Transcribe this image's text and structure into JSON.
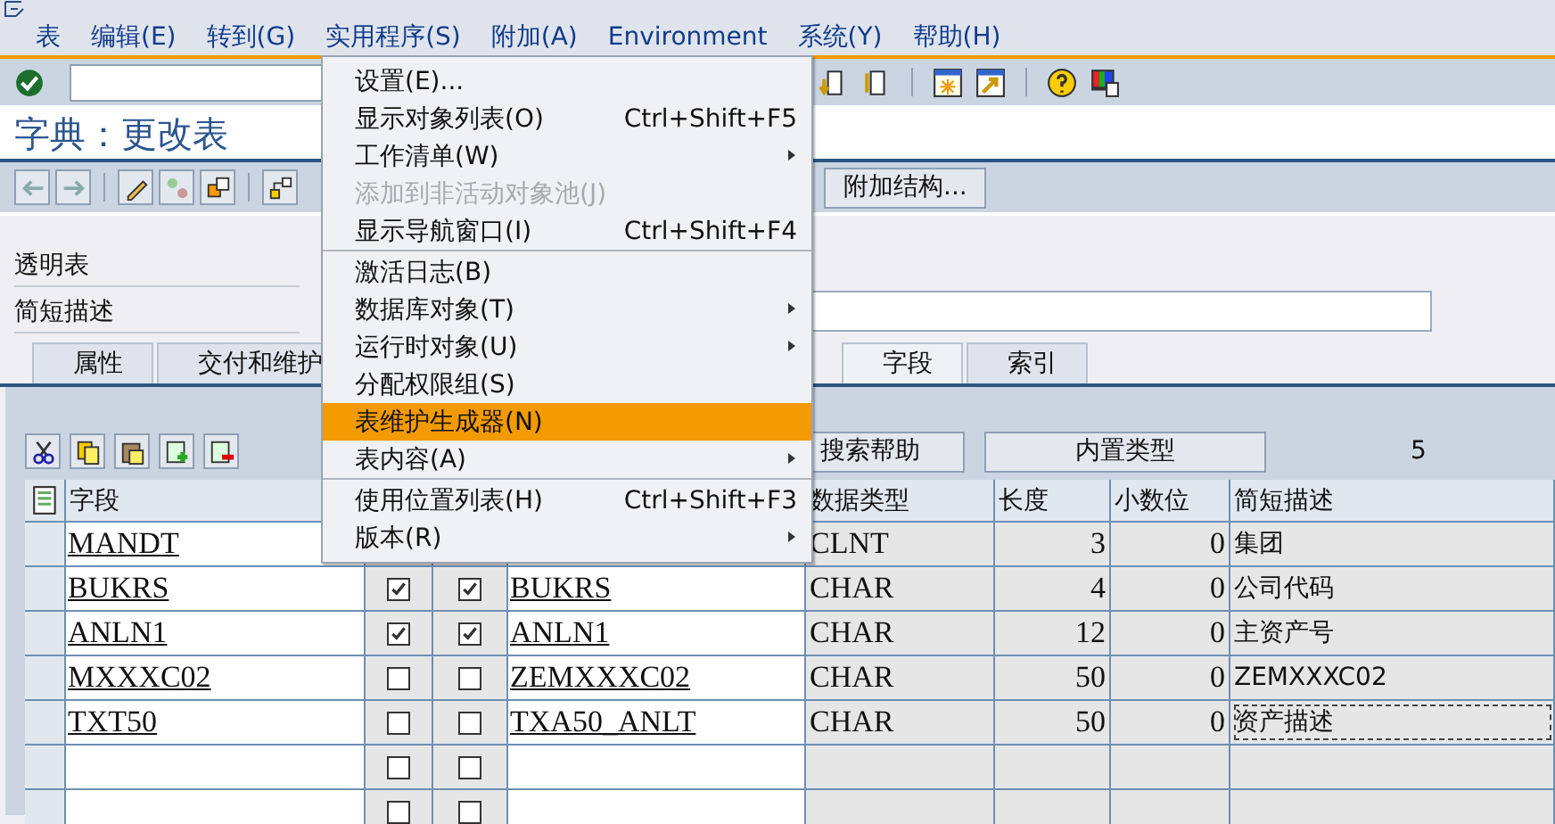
{
  "menubar": [
    "表",
    "编辑(E)",
    "转到(G)",
    "实用程序(S)",
    "附加(A)",
    "Environment",
    "系统(Y)",
    "帮助(H)"
  ],
  "title": "字典：更改表",
  "app_buttons": [
    "附加结构..."
  ],
  "table_type_label": "透明表",
  "description_label": "简短描述",
  "tabs": [
    {
      "label": "属性",
      "selected": false
    },
    {
      "label": "交付和维护",
      "selected": false
    },
    {
      "label": "字段",
      "selected": true
    },
    {
      "label": "索引",
      "selected": false
    }
  ],
  "table_buttons": [
    "搜索帮助",
    "内置类型"
  ],
  "count": "5",
  "columns": [
    "字段",
    "数据类型",
    "长度",
    "小数位",
    "简短描述"
  ],
  "rows": [
    {
      "field": "MANDT",
      "data_type": "CLNT",
      "length": "3",
      "decimals": "0",
      "description": "集团",
      "focused": false
    },
    {
      "field": "BUKRS",
      "key": true,
      "initial": true,
      "data_element": "BUKRS",
      "data_type": "CHAR",
      "length": "4",
      "decimals": "0",
      "description": "公司代码",
      "focused": false
    },
    {
      "field": "ANLN1",
      "key": true,
      "initial": true,
      "data_element": "ANLN1",
      "data_type": "CHAR",
      "length": "12",
      "decimals": "0",
      "description": "主资产号",
      "focused": false
    },
    {
      "field": "MXXXC02",
      "key": false,
      "initial": false,
      "data_element": "ZEMXXXC02",
      "data_type": "CHAR",
      "length": "50",
      "decimals": "0",
      "description": "ZEMXXXC02",
      "focused": false
    },
    {
      "field": "TXT50",
      "key": false,
      "initial": false,
      "data_element": "TXA50_ANLT",
      "data_type": "CHAR",
      "length": "50",
      "decimals": "0",
      "description": "资产描述",
      "focused": true
    },
    {
      "key": false,
      "initial": false
    },
    {
      "key": false,
      "initial": false
    }
  ],
  "menu": [
    {
      "label": "设置(E)...",
      "disabled": false,
      "selected": false
    },
    {
      "label": "显示对象列表(O)",
      "shortcut": "Ctrl+Shift+F5",
      "disabled": false,
      "selected": false
    },
    {
      "label": "工作清单(W)",
      "submenu": true,
      "disabled": false,
      "selected": false
    },
    {
      "label": "添加到非活动对象池(J)",
      "disabled": true,
      "selected": false
    },
    {
      "label": "显示导航窗口(I)",
      "shortcut": "Ctrl+Shift+F4",
      "disabled": false,
      "selected": false,
      "separator_after": true
    },
    {
      "label": "激活日志(B)",
      "disabled": false,
      "selected": false
    },
    {
      "label": "数据库对象(T)",
      "submenu": true,
      "disabled": false,
      "selected": false
    },
    {
      "label": "运行时对象(U)",
      "submenu": true,
      "disabled": false,
      "selected": false
    },
    {
      "label": "分配权限组(S)",
      "disabled": false,
      "selected": false
    },
    {
      "label": "表维护生成器(N)",
      "disabled": false,
      "selected": true
    },
    {
      "label": "表内容(A)",
      "submenu": true,
      "disabled": false,
      "selected": false,
      "separator_after": true
    },
    {
      "label": "使用位置列表(H)",
      "shortcut": "Ctrl+Shift+F3",
      "disabled": false,
      "selected": false
    },
    {
      "label": "版本(R)",
      "submenu": true,
      "disabled": false,
      "selected": false
    }
  ]
}
